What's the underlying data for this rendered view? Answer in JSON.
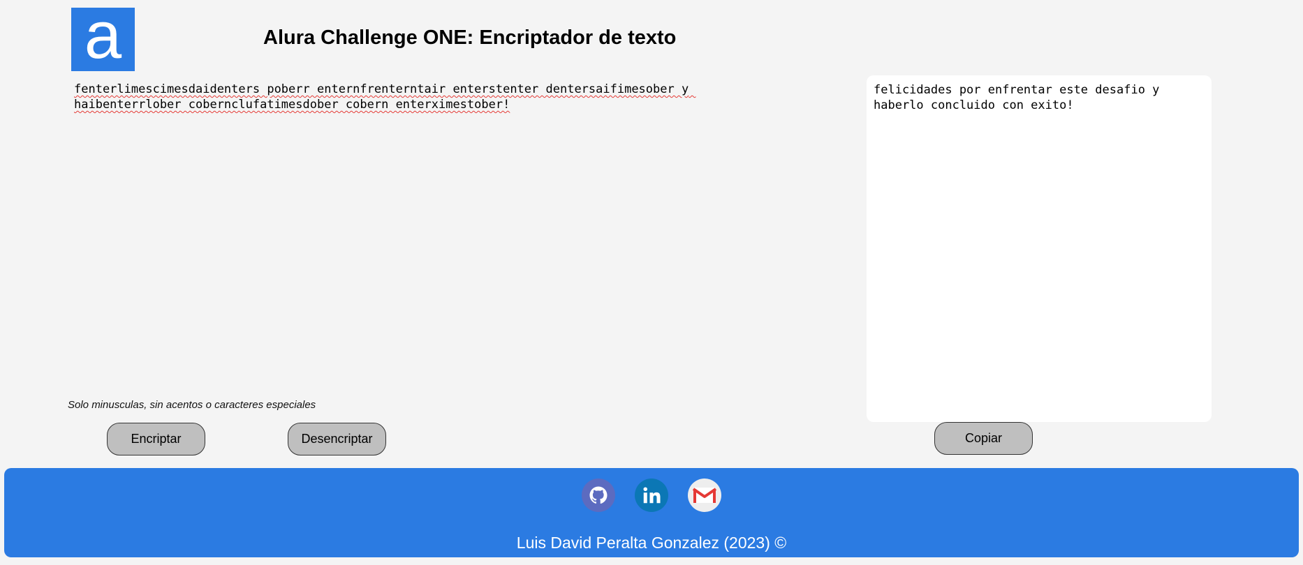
{
  "header": {
    "logo_letter": "a",
    "title": "Alura Challenge ONE: Encriptador de texto"
  },
  "input": {
    "value": "fenterlimescimesdaidenters poberr enternfrenterntair enterstenter dentersaifimesober y haibenterrlober cobernclufatimesdober cobern enterximestober!"
  },
  "hint": "Solo minusculas, sin acentos o caracteres especiales",
  "buttons": {
    "encrypt": "Encriptar",
    "decrypt": "Desencriptar",
    "copy": "Copiar"
  },
  "output": {
    "text": "felicidades por enfrentar este desafio y haberlo concluido con exito!"
  },
  "footer": {
    "social": [
      {
        "icon": "github-icon"
      },
      {
        "icon": "linkedin-icon"
      },
      {
        "icon": "gmail-icon"
      }
    ],
    "credit": "Luis David Peralta Gonzalez (2023) ©"
  },
  "colors": {
    "accent": "#2b7be2",
    "background": "#f4f4f4",
    "button": "#bfbfbf"
  }
}
